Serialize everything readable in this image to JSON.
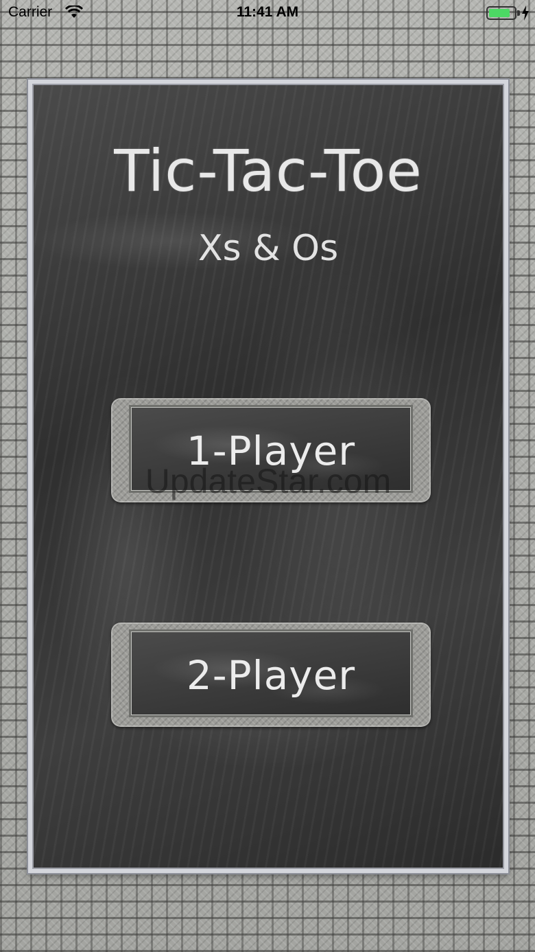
{
  "status_bar": {
    "carrier": "Carrier",
    "time": "11:41 AM",
    "battery_color": "#4cd964",
    "battery_level": 0.82
  },
  "screen": {
    "title": "Tic-Tac-Toe",
    "subtitle": "Xs & Os"
  },
  "buttons": {
    "one_player": "1-Player",
    "two_player": "2-Player"
  },
  "watermark": "UpdateStar.com"
}
